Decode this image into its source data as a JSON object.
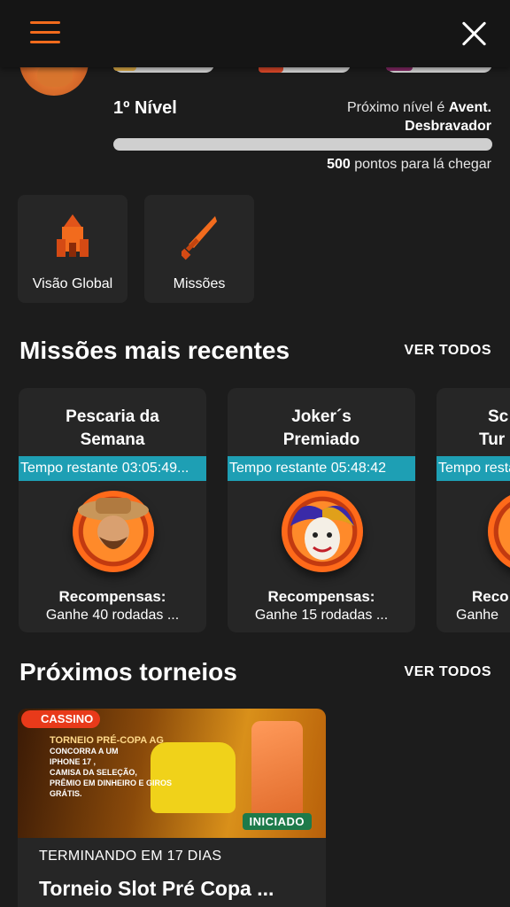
{
  "header": {
    "menu_icon": "hamburger-menu-icon",
    "close_icon": "close-icon"
  },
  "level": {
    "current": "1º Nível",
    "next_prefix": "Próximo nível é ",
    "next_name": "Avent. Desbravador",
    "progress_fraction": 0.0,
    "points": "500",
    "points_suffix": " pontos para lá chegar"
  },
  "tiles": [
    {
      "label": "Visão Global",
      "icon": "castle-icon"
    },
    {
      "label": "Missões",
      "icon": "sword-icon"
    }
  ],
  "missions_section": {
    "title": "Missões mais recentes",
    "see_all": "VER TODOS"
  },
  "missions": [
    {
      "title_line1": "Pescaria da",
      "title_line2": "Semana",
      "timer": "Tempo restante 03:05:49...",
      "reward_label": "Recompensas:",
      "reward": "Ganhe 40 rodadas ..."
    },
    {
      "title_line1": "Joker´s",
      "title_line2": "Premiado",
      "timer": "Tempo restante 05:48:42",
      "reward_label": "Recompensas:",
      "reward": "Ganhe 15 rodadas ..."
    },
    {
      "title_line1": "Sc",
      "title_line2": "Tur",
      "timer": "Tempo resta",
      "reward_label": "Reco",
      "reward": "Ganhe"
    }
  ],
  "tournaments_section": {
    "title": "Próximos torneios",
    "see_all": "VER TODOS"
  },
  "tournament": {
    "banner_tag": "CASSINO",
    "banner_title": "TORNEIO PRÉ-COPA AG",
    "banner_line1": "CONCORRA A UM",
    "banner_line2": "IPHONE 17 ,",
    "banner_line3": "CAMISA DA SELEÇÃO,",
    "banner_line4": "PRÊMIO EM DINHEIRO E GIROS GRÁTIS.",
    "status": "INICIADO",
    "ending": "TERMINANDO EM 17 DIAS",
    "name": "Torneio Slot Pré Copa ..."
  },
  "colors": {
    "accent": "#f26b1d",
    "timer": "#1e9fb4",
    "background": "#1c1c1c",
    "card": "#262626"
  }
}
